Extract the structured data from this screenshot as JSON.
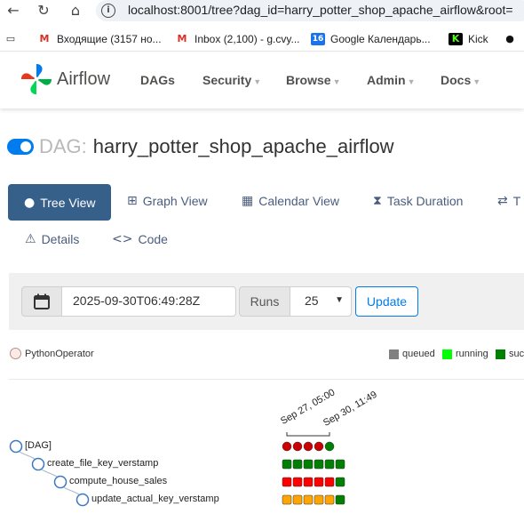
{
  "browser": {
    "url": "localhost:8001/tree?dag_id=harry_potter_shop_apache_airflow&root=",
    "bookmarks": [
      {
        "label": "Входящие (3157 но...",
        "icon": "gmail-icon",
        "icon_char": "M",
        "color": "#d93025"
      },
      {
        "label": "Inbox (2,100) - g.cvy...",
        "icon": "gmail-icon",
        "icon_char": "M",
        "color": "#d93025"
      },
      {
        "label": "Google Календарь...",
        "icon": "calendar-icon",
        "icon_char": "16",
        "color": "#1a73e8"
      },
      {
        "label": "Kick",
        "icon": "kick-icon",
        "icon_char": "K",
        "color": "#53fc18"
      }
    ]
  },
  "navbar": {
    "brand": "Airflow",
    "items": [
      "DAGs",
      "Security",
      "Browse",
      "Admin",
      "Docs"
    ],
    "has_caret": [
      false,
      true,
      true,
      true,
      true
    ]
  },
  "dag": {
    "prefix": "DAG:",
    "name": "harry_potter_shop_apache_airflow",
    "paused": false
  },
  "tabs": {
    "row1": [
      {
        "label": "Tree View",
        "icon": "tree-icon",
        "active": true
      },
      {
        "label": "Graph View",
        "icon": "graph-icon",
        "active": false
      },
      {
        "label": "Calendar View",
        "icon": "calendar-icon",
        "active": false
      },
      {
        "label": "Task Duration",
        "icon": "hourglass-icon",
        "active": false
      },
      {
        "label": "T",
        "icon": "transfer-icon",
        "active": false
      }
    ],
    "row2": [
      {
        "label": "Details",
        "icon": "warning-icon"
      },
      {
        "label": "Code",
        "icon": "code-icon"
      }
    ]
  },
  "controls": {
    "base_date": "2025-09-30T06:49:28Z",
    "runs_label": "Runs",
    "runs_value": "25",
    "update_label": "Update"
  },
  "legend": {
    "operator": "PythonOperator",
    "states": [
      {
        "label": "queued",
        "color": "#808080"
      },
      {
        "label": "running",
        "color": "#00ff00"
      },
      {
        "label": "suc",
        "color": "#008000"
      }
    ]
  },
  "tree": {
    "dates": [
      "Sep 27, 05:00",
      "Sep 30, 11:49"
    ],
    "tasks": [
      {
        "label": "[DAG]",
        "level": 0,
        "shape": "circle",
        "states": [
          "#cc0000",
          "#cc0000",
          "#cc0000",
          "#cc0000",
          "#008000"
        ]
      },
      {
        "label": "create_file_key_verstamp",
        "level": 1,
        "shape": "square",
        "states": [
          "#008000",
          "#008000",
          "#008000",
          "#008000",
          "#008000",
          "#008000"
        ]
      },
      {
        "label": "compute_house_sales",
        "level": 2,
        "shape": "square",
        "states": [
          "#ff0000",
          "#ff0000",
          "#ff0000",
          "#ff0000",
          "#ff0000",
          "#008000"
        ]
      },
      {
        "label": "update_actual_key_verstamp",
        "level": 3,
        "shape": "square",
        "states": [
          "#ffa500",
          "#ffa500",
          "#ffa500",
          "#ffa500",
          "#ffa500",
          "#008000"
        ]
      }
    ]
  }
}
